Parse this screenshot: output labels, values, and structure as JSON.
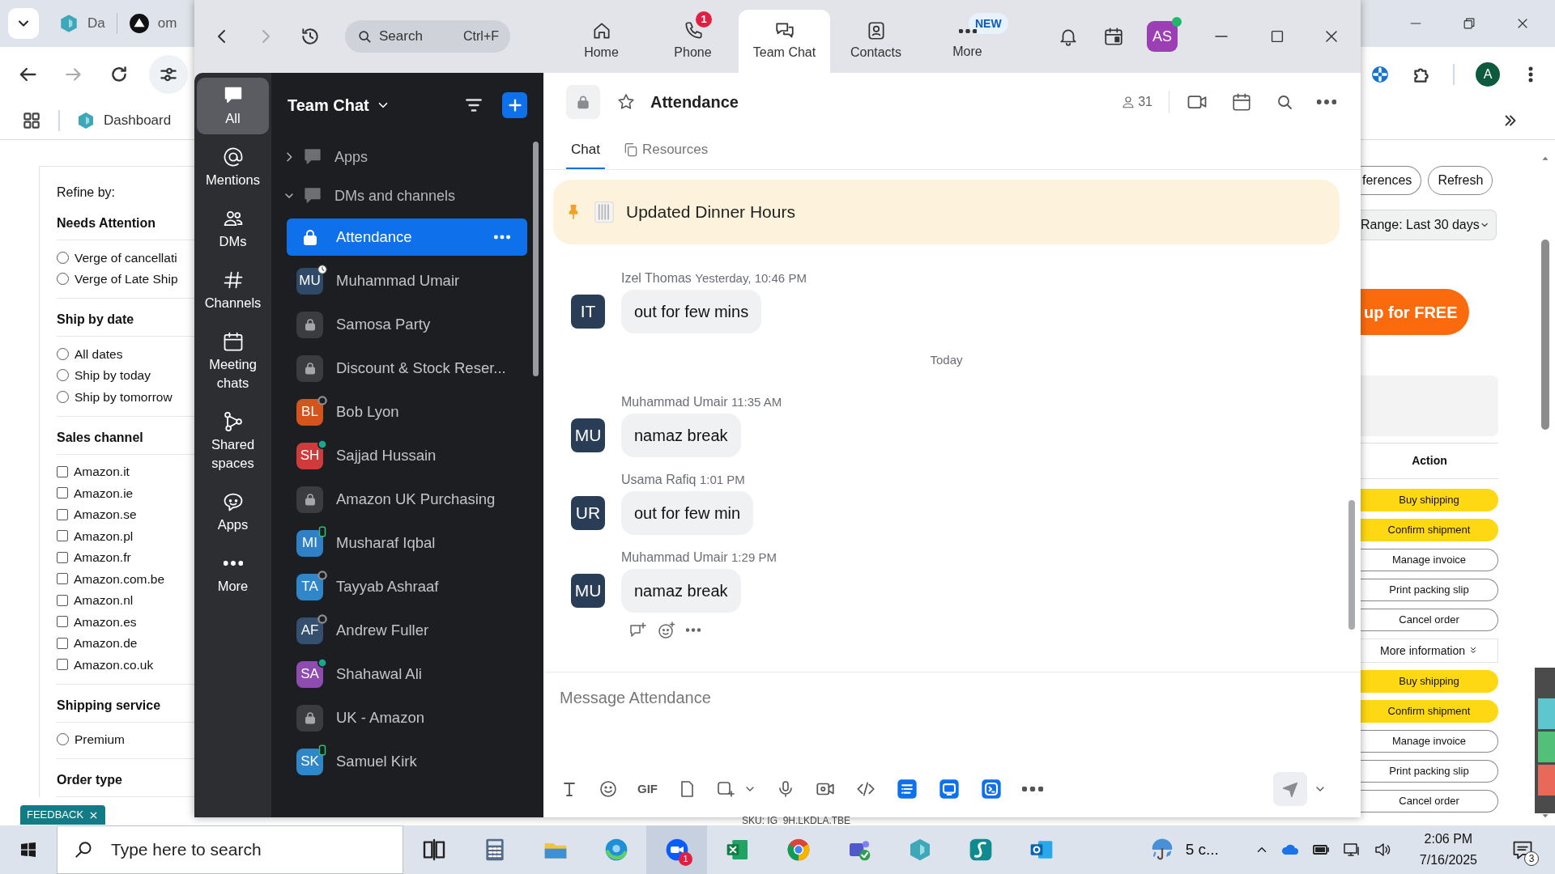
{
  "browser": {
    "tabs": [
      {
        "label": "Da"
      },
      {
        "label": "om"
      }
    ],
    "profile": "A",
    "bookmarks": [
      {
        "label": "Dashboard"
      }
    ],
    "filters": {
      "title": "Refine by:",
      "groups": [
        {
          "title": "Needs Attention",
          "kind": "radio",
          "options": [
            {
              "label": "Verge of cancellati",
              "checked": false
            },
            {
              "label": "Verge of Late Ship",
              "checked": false
            }
          ]
        },
        {
          "title": "Ship by date",
          "kind": "radio",
          "options": [
            {
              "label": "All dates",
              "checked": false
            },
            {
              "label": "Ship by today",
              "checked": false
            },
            {
              "label": "Ship by tomorrow",
              "checked": false
            }
          ]
        },
        {
          "title": "Sales channel",
          "kind": "checkbox",
          "options": [
            {
              "label": "Amazon.it",
              "checked": false
            },
            {
              "label": "Amazon.ie",
              "checked": false
            },
            {
              "label": "Amazon.se",
              "checked": false
            },
            {
              "label": "Amazon.pl",
              "checked": false
            },
            {
              "label": "Amazon.fr",
              "checked": false
            },
            {
              "label": "Amazon.com.be",
              "checked": false
            },
            {
              "label": "Amazon.nl",
              "checked": false
            },
            {
              "label": "Amazon.es",
              "checked": false
            },
            {
              "label": "Amazon.de",
              "checked": false
            },
            {
              "label": "Amazon.co.uk",
              "checked": false
            }
          ]
        },
        {
          "title": "Shipping service",
          "kind": "radio",
          "options": [
            {
              "label": "Premium",
              "checked": false
            }
          ]
        },
        {
          "title": "Order type"
        }
      ]
    },
    "feedback": "FEEDBACK",
    "orders": {
      "buttons": [
        "ferences",
        "Refresh"
      ],
      "range": "Range: Last 30 days",
      "promo": "up for FREE",
      "action_header": "Action",
      "actions": [
        {
          "kind": "primary",
          "label": "Buy shipping"
        },
        {
          "kind": "primary",
          "label": "Confirm shipment"
        },
        {
          "kind": "secondary",
          "label": "Manage invoice"
        },
        {
          "kind": "secondary",
          "label": "Print packing slip"
        },
        {
          "kind": "secondary",
          "label": "Cancel order"
        },
        {
          "kind": "more",
          "label": "More information"
        },
        {
          "kind": "primary",
          "label": "Buy shipping"
        },
        {
          "kind": "primary",
          "label": "Confirm shipment"
        },
        {
          "kind": "secondary",
          "label": "Manage invoice"
        },
        {
          "kind": "secondary",
          "label": "Print packing slip"
        },
        {
          "kind": "secondary",
          "label": "Cancel order"
        }
      ]
    },
    "footer_text": "SKU: IG_9H.LKDLA.TBE"
  },
  "zoom": {
    "search": {
      "placeholder": "Search",
      "shortcut": "Ctrl+F"
    },
    "tabs": [
      {
        "kind": "home",
        "label": "Home",
        "selected": false
      },
      {
        "kind": "phone",
        "label": "Phone",
        "badge": {
          "kind": "count",
          "text": "1"
        },
        "selected": false
      },
      {
        "kind": "chat",
        "label": "Team Chat",
        "selected": true
      },
      {
        "kind": "contacts",
        "label": "Contacts",
        "selected": false
      },
      {
        "kind": "more",
        "label": "More",
        "badge": {
          "kind": "new",
          "text": "NEW"
        },
        "selected": false
      }
    ],
    "user": {
      "initials": "AS",
      "color": "#9c3fb5",
      "presence": {
        "kind": "online"
      }
    },
    "rail": [
      {
        "kind": "all",
        "label": "All",
        "selected": true
      },
      {
        "kind": "mentions",
        "label": "Mentions",
        "selected": false
      },
      {
        "kind": "dms",
        "label": "DMs",
        "selected": false
      },
      {
        "kind": "channels",
        "label": "Channels",
        "selected": false
      },
      {
        "kind": "meetings",
        "label": "Meeting chats",
        "selected": false
      },
      {
        "kind": "shared",
        "label": "Shared spaces",
        "selected": false
      },
      {
        "kind": "apps",
        "label": "Apps",
        "selected": false
      },
      {
        "kind": "more",
        "label": "More",
        "selected": false
      }
    ],
    "list": {
      "title": "Team Chat",
      "sections": [
        {
          "label": "Apps",
          "expanded": false
        },
        {
          "label": "DMs and channels",
          "expanded": true,
          "items": [
            {
              "kind": "channel",
              "name": "Attendance",
              "selected": true
            },
            {
              "kind": "dm",
              "name": "Muhammad Umair",
              "initials": "MU",
              "color": "#2e4a68",
              "presence": {
                "kind": "away"
              },
              "selected": false
            },
            {
              "kind": "channel",
              "name": "Samosa Party",
              "selected": false
            },
            {
              "kind": "channel",
              "name": "Discount & Stock Reser...",
              "selected": false
            },
            {
              "kind": "dm",
              "name": "Bob Lyon",
              "initials": "BL",
              "color": "#d4541e",
              "presence": {
                "kind": "offline"
              },
              "selected": false
            },
            {
              "kind": "dm",
              "name": "Sajjad Hussain",
              "initials": "SH",
              "color": "#cf3b3b",
              "presence": {
                "kind": "online"
              },
              "selected": false
            },
            {
              "kind": "channel",
              "name": "Amazon UK Purchasing",
              "selected": false
            },
            {
              "kind": "dm",
              "name": "Musharaf Iqbal",
              "initials": "MI",
              "color": "#2f80c4",
              "presence": {
                "kind": "mobile"
              },
              "selected": false
            },
            {
              "kind": "dm",
              "name": "Tayyab Ashraaf",
              "initials": "TA",
              "color": "#2f86c9",
              "presence": {
                "kind": "offline"
              },
              "selected": false
            },
            {
              "kind": "dm",
              "name": "Andrew Fuller",
              "initials": "AF",
              "color": "#35506f",
              "presence": {
                "kind": "offline"
              },
              "selected": false
            },
            {
              "kind": "dm",
              "name": "Shahawal Ali",
              "initials": "SA",
              "color": "#8e4bb0",
              "presence": {
                "kind": "online"
              },
              "selected": false
            },
            {
              "kind": "channel",
              "name": "UK - Amazon",
              "selected": false
            },
            {
              "kind": "dm",
              "name": "Samuel Kirk",
              "initials": "SK",
              "color": "#2f86c9",
              "presence": {
                "kind": "mobile"
              },
              "selected": false
            }
          ]
        }
      ]
    },
    "chat": {
      "title": "Attendance",
      "members": "31",
      "tabs": [
        {
          "kind": "chat",
          "label": "Chat",
          "selected": true
        },
        {
          "kind": "resources",
          "label": "Resources",
          "selected": false
        }
      ],
      "pinned": "Updated Dinner Hours",
      "timeline": [
        {
          "kind": "message",
          "initials": "IT",
          "sender": "Izel Thomas",
          "time": "Yesterday, 10:46 PM",
          "text": "out for few mins",
          "hovered": false
        },
        {
          "kind": "divider",
          "text": "Today"
        },
        {
          "kind": "message",
          "initials": "MU",
          "sender": "Muhammad Umair",
          "time": "11:35 AM",
          "text": "namaz break",
          "hovered": false
        },
        {
          "kind": "message",
          "initials": "UR",
          "sender": "Usama Rafiq",
          "time": "1:01 PM",
          "text": "out for few min",
          "hovered": false
        },
        {
          "kind": "message",
          "initials": "MU",
          "sender": "Muhammad Umair",
          "time": "1:29 PM",
          "text": "namaz break",
          "hovered": true
        }
      ],
      "composer": {
        "placeholder": "Message Attendance",
        "gif_label": "GIF"
      }
    }
  },
  "taskbar": {
    "search": {
      "placeholder": "Type here to search"
    },
    "apps": [
      {
        "kind": "taskview",
        "active": false
      },
      {
        "kind": "calculator",
        "active": false
      },
      {
        "kind": "explorer",
        "active": false
      },
      {
        "kind": "edge",
        "active": false
      },
      {
        "kind": "zoom",
        "badge": "1",
        "active": true
      },
      {
        "kind": "excel",
        "active": false
      },
      {
        "kind": "chrome",
        "active": false
      },
      {
        "kind": "teams",
        "active": false
      },
      {
        "kind": "hexagon",
        "active": false
      },
      {
        "kind": "s-app",
        "active": false
      },
      {
        "kind": "outlook",
        "active": false
      }
    ],
    "weather": "5 c...",
    "time": "2:06 PM",
    "date": "7/16/2025",
    "notifications": "3"
  }
}
